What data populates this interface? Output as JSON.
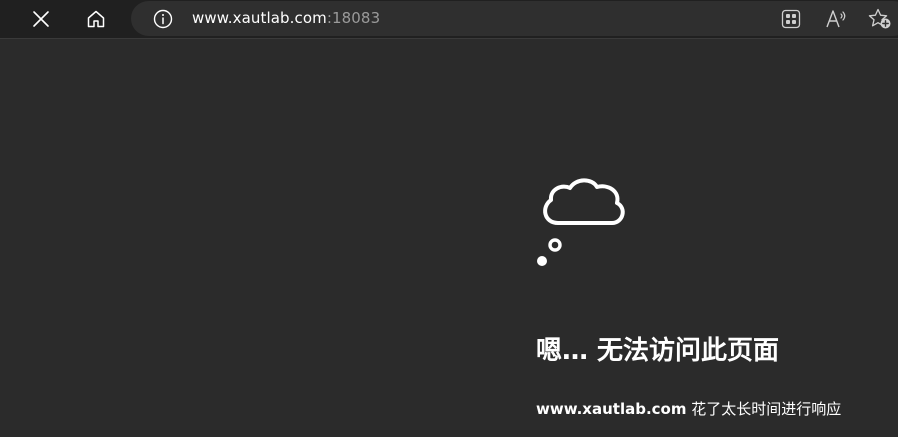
{
  "toolbar": {
    "close_icon": "close-icon",
    "home_icon": "home-icon",
    "info_icon": "info-icon",
    "url_host": "www.xautlab.com",
    "url_port": ":18083",
    "apps_icon": "apps-icon",
    "read_aloud_icon": "read-aloud-icon",
    "favorite_icon": "favorite-add-icon"
  },
  "error": {
    "icon": "thought-cloud-icon",
    "title": "嗯… 无法访问此页面",
    "host": "www.xautlab.com",
    "message": " 花了太长时间进行响应"
  },
  "colors": {
    "background": "#2b2b2b",
    "toolbar": "#202020",
    "address_bar": "#2f2f2f",
    "text": "#ffffff",
    "port_text": "#9a9a9a"
  }
}
